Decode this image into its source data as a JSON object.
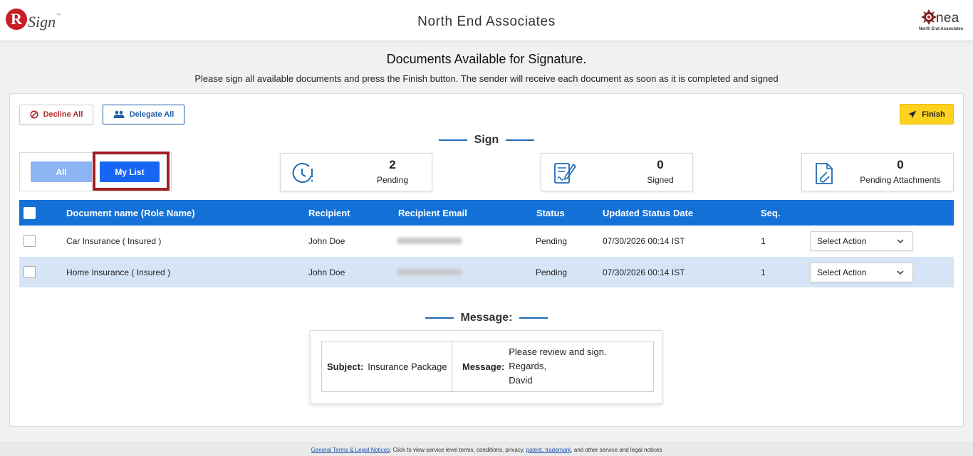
{
  "header": {
    "brand_logo": {
      "letter": "R",
      "text": "Sign",
      "tm": "™"
    },
    "title": "North End Associates",
    "company_logo": {
      "text": "nea",
      "subtitle": "North End Associates"
    }
  },
  "page": {
    "heading": "Documents Available for Signature.",
    "instructions": "Please sign all available documents and press the Finish button. The sender will receive each document as soon as it is completed and signed"
  },
  "toolbar": {
    "decline_all": "Decline All",
    "delegate_all": "Delegate All",
    "finish": "Finish"
  },
  "sign_section": {
    "title": "Sign",
    "toggle": {
      "all": "All",
      "my_list": "My List",
      "selected": "My List"
    },
    "stats": [
      {
        "icon": "clock-alert-icon",
        "value": "2",
        "label": "Pending"
      },
      {
        "icon": "signed-document-icon",
        "value": "0",
        "label": "Signed"
      },
      {
        "icon": "paperclip-document-icon",
        "value": "0",
        "label": "Pending Attachments"
      }
    ]
  },
  "table": {
    "columns": [
      "Document name (Role Name)",
      "Recipient",
      "Recipient Email",
      "Status",
      "Updated Status Date",
      "Seq."
    ],
    "rows": [
      {
        "document": "Car Insurance ( Insured )",
        "recipient": "John Doe",
        "email": "",
        "status": "Pending",
        "date": "07/30/2026 00:14 IST",
        "seq": "1",
        "action": "Select Action"
      },
      {
        "document": "Home Insurance ( Insured )",
        "recipient": "John Doe",
        "email": "",
        "status": "Pending",
        "date": "07/30/2026 00:14 IST",
        "seq": "1",
        "action": "Select Action"
      }
    ]
  },
  "message_section": {
    "title": "Message:",
    "subject_label": "Subject:",
    "subject": "Insurance Package",
    "message_label": "Message:",
    "message_lines": [
      "Please review and sign.",
      "Regards,",
      "David"
    ]
  },
  "footer": {
    "link1": "General Terms & Legal Notices",
    "text1": ": Click to view service level terms, conditions, privacy, ",
    "link2": "patent, trademark",
    "text2": ", and other service and legal notices"
  },
  "colors": {
    "primary_blue": "#1370d6",
    "toggle_selected": "#1665f5",
    "finish_yellow": "#ffd21f",
    "decline_red": "#b22a2a",
    "highlight_red": "#a11e24",
    "row_alt": "#d6e5f5"
  }
}
